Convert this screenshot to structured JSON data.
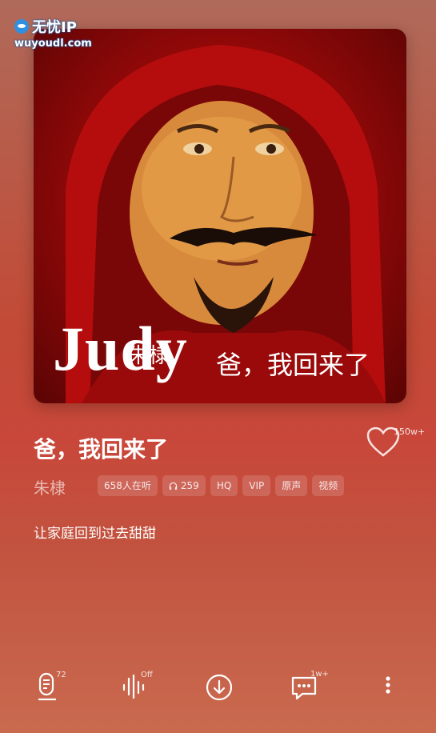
{
  "watermark": {
    "title": "无忧IP",
    "url": "wuyoudl.com"
  },
  "cover": {
    "artist_text": "朱棣",
    "brand_text": "Judy",
    "title_text": "爸，我回来了"
  },
  "song": {
    "title": "爸，我回来了",
    "artist": "朱棣",
    "like_count": "150w+"
  },
  "tags": [
    {
      "label": "658人在听",
      "icon": ""
    },
    {
      "label": "259",
      "icon": "headphones-icon"
    },
    {
      "label": "HQ",
      "icon": ""
    },
    {
      "label": "VIP",
      "icon": ""
    },
    {
      "label": "原声",
      "icon": ""
    },
    {
      "label": "视频",
      "icon": ""
    }
  ],
  "lyric": "让家庭回到过去甜甜",
  "bottom_bar": {
    "lyrics_badge": "72",
    "effect_badge": "Off",
    "comments_badge": "1w+"
  },
  "colors": {
    "accent": "#c8473a",
    "cover_red": "#c01010"
  }
}
